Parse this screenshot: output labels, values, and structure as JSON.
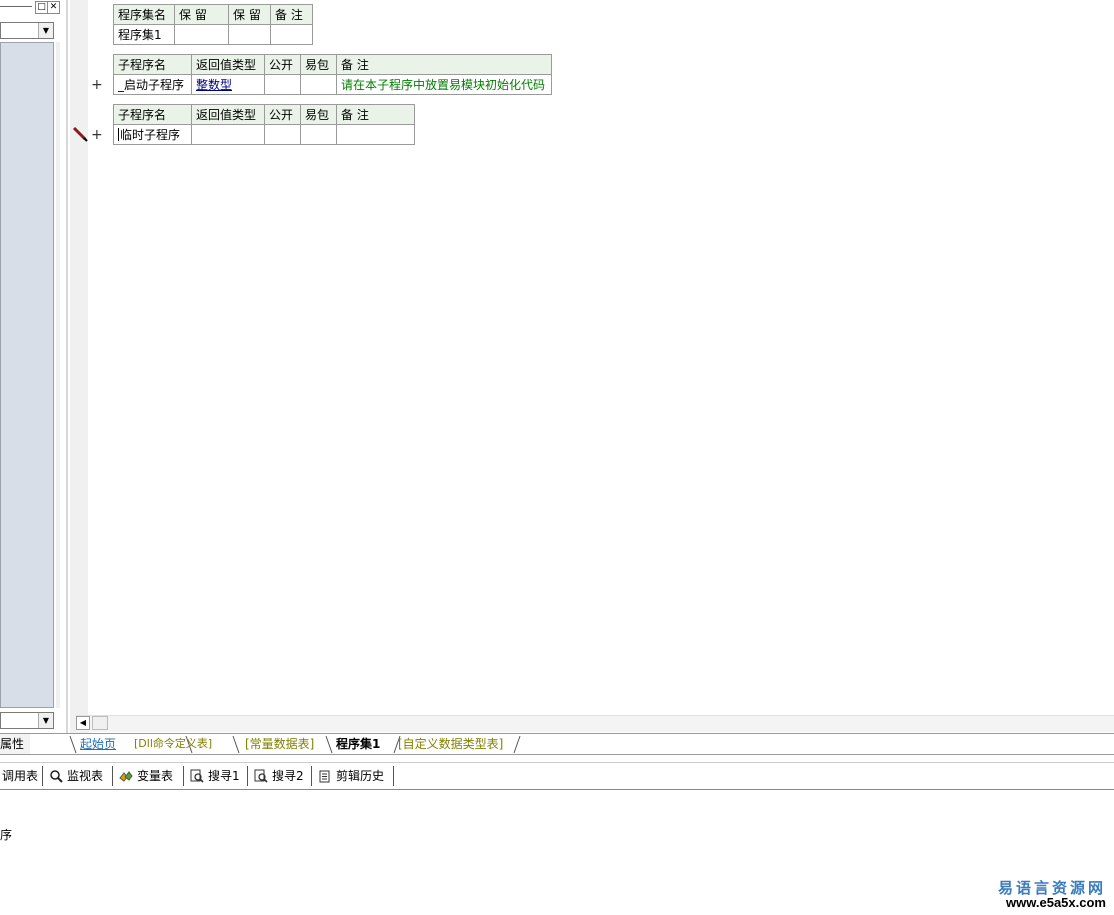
{
  "left_panel": {
    "prop_tab_label": "属性"
  },
  "assembly_table": {
    "headers": [
      "程序集名",
      "保 留",
      "保 留",
      "备 注"
    ],
    "row": [
      "程序集1",
      "",
      "",
      ""
    ]
  },
  "sub_table_1": {
    "headers": [
      "子程序名",
      "返回值类型",
      "公开",
      "易包",
      "备 注"
    ],
    "name": "_启动子程序",
    "return_type": "整数型",
    "public": "",
    "easy_pkg": "",
    "remark": "请在本子程序中放置易模块初始化代码"
  },
  "sub_table_2": {
    "headers": [
      "子程序名",
      "返回值类型",
      "公开",
      "易包",
      "备 注"
    ],
    "name": "临时子程序",
    "return_type": "",
    "public": "",
    "easy_pkg": "",
    "remark": ""
  },
  "gutter": {
    "plus_1": "+",
    "plus_2": "+"
  },
  "tabs": [
    {
      "label": "起始页"
    },
    {
      "label": "[Dll命令定义表]"
    },
    {
      "label": "[常量数据表]"
    },
    {
      "label": "程序集1"
    },
    {
      "label": "[自定义数据类型表]"
    }
  ],
  "toolbar": {
    "items": [
      {
        "label": "调用表"
      },
      {
        "label": "监视表"
      },
      {
        "label": "变量表"
      },
      {
        "label": "搜寻1"
      },
      {
        "label": "搜寻2"
      },
      {
        "label": "剪辑历史"
      }
    ]
  },
  "output": {
    "line_1": "序"
  },
  "watermark": {
    "cn": "易语言资源网",
    "url": "www.e5a5x.com"
  },
  "colors": {
    "header_bg": "#e9f3e7",
    "remark_green": "#008000",
    "type_link": "#000080",
    "tab_inactive": "#808000",
    "tab_start": "#1e6fb5",
    "left_list_bg": "#d7dee7"
  }
}
